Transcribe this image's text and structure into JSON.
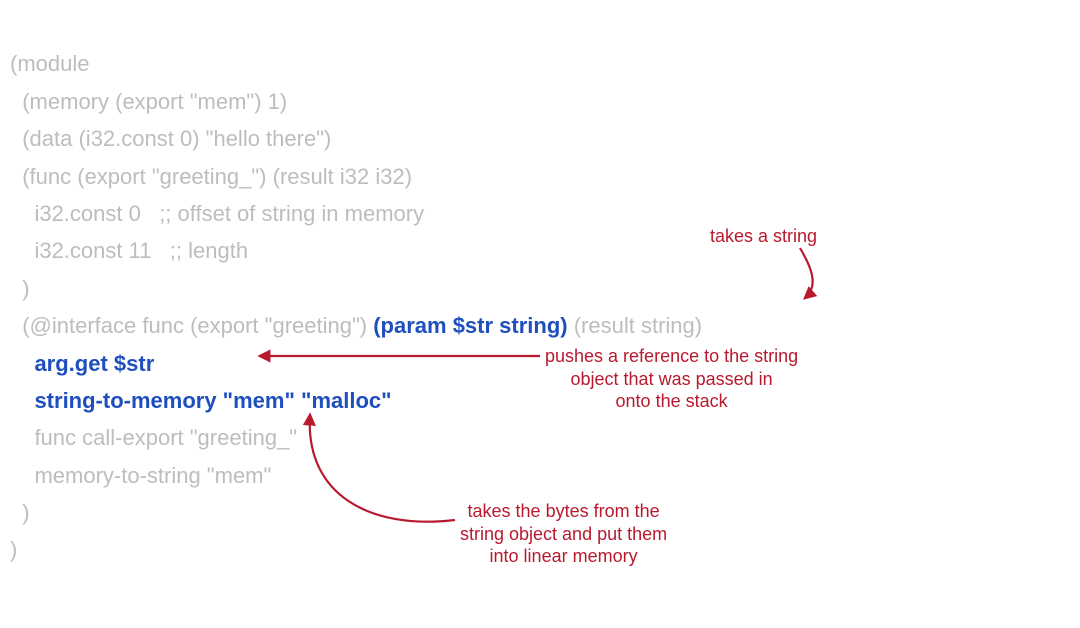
{
  "code": {
    "l1": "(module",
    "l2": "  (memory (export \"mem\") 1)",
    "l3": "  (data (i32.const 0) \"hello there\")",
    "l4": "  (func (export \"greeting_\") (result i32 i32)",
    "l5": "    i32.const 0   ;; offset of string in memory",
    "l6": "    i32.const 11   ;; length",
    "l7": "  )",
    "l8a": "  (@interface func (export \"greeting\") ",
    "l8b": "(param $str string)",
    "l8c": " (result string)",
    "l9": "    arg.get $str",
    "l10": "    string-to-memory \"mem\" \"malloc\"",
    "l11": "    func call-export \"greeting_\"",
    "l12": "    memory-to-string \"mem\"",
    "l13": "  )",
    "l14": ")"
  },
  "annotations": {
    "takes": "takes a string",
    "pushes": "pushes a reference to the string\nobject that was passed in\nonto the stack",
    "bytes": "takes the bytes from the\nstring object and put them\ninto linear memory"
  },
  "colors": {
    "faded": "#bdbdbd",
    "blue": "#1f4fbf",
    "annot": "#b9192e"
  }
}
